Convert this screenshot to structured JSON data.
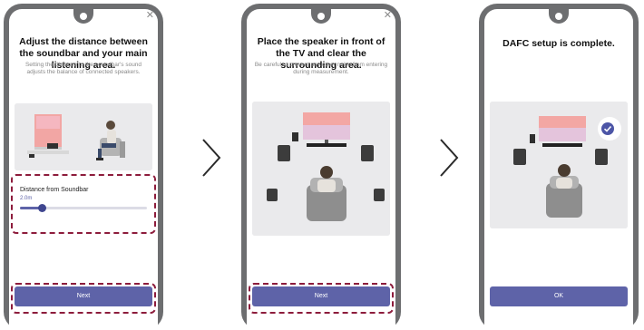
{
  "steps": [
    {
      "title": "Adjust the distance between the soundbar and your main listening area.",
      "description": "Setting the distance to the soundbar's sound adjusts the balance of connected speakers.",
      "slider": {
        "label": "Distance from Soundbar",
        "value_text": "2.0m",
        "fraction": 0.17
      },
      "button_label": "Next"
    },
    {
      "title": "Place the speaker in front of the TV and clear the surrounding area.",
      "description": "Be careful to prevent any other noise from entering during measurement.",
      "button_label": "Next"
    },
    {
      "title": "DAFC setup is complete.",
      "button_label": "OK"
    }
  ],
  "colors": {
    "accent": "#5e63a8",
    "highlight": "#8d1c3c",
    "phone_frame": "#6d6e70"
  },
  "icons": [
    "close-icon",
    "chevron-right-icon",
    "check-icon"
  ]
}
